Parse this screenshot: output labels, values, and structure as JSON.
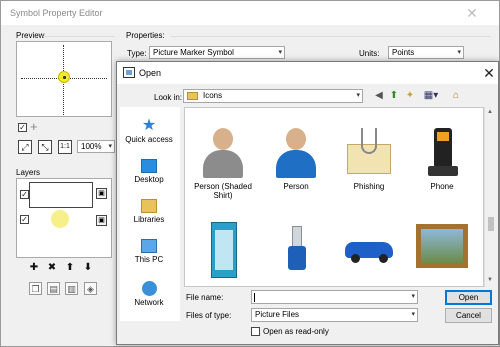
{
  "editor": {
    "title": "Symbol Property Editor",
    "preview_label": "Preview",
    "properties_label": "Properties:",
    "type_label": "Type:",
    "type_value": "Picture Marker Symbol",
    "units_label": "Units:",
    "units_value": "Points",
    "zoom_value": "100%",
    "layers_label": "Layers"
  },
  "open_dialog": {
    "title": "Open",
    "look_in_label": "Look in:",
    "look_in_value": "Icons",
    "places": [
      {
        "label": "Quick access",
        "icon": "star-icon"
      },
      {
        "label": "Desktop",
        "icon": "desktop-icon"
      },
      {
        "label": "Libraries",
        "icon": "libraries-icon"
      },
      {
        "label": "This PC",
        "icon": "computer-icon"
      },
      {
        "label": "Network",
        "icon": "network-icon"
      }
    ],
    "files": [
      {
        "label": "Person (Shaded Shirt)",
        "icon": "person-shaded-shirt-icon"
      },
      {
        "label": "Person",
        "icon": "person-icon"
      },
      {
        "label": "Phishing",
        "icon": "phishing-icon"
      },
      {
        "label": "Phone",
        "icon": "phone-icon"
      },
      {
        "label": "",
        "icon": "phone-booth-icon"
      },
      {
        "label": "",
        "icon": "usb-drive-icon"
      },
      {
        "label": "",
        "icon": "car-icon"
      },
      {
        "label": "",
        "icon": "framed-picture-icon"
      }
    ],
    "file_name_label": "File name:",
    "file_name_value": "",
    "files_of_type_label": "Files of type:",
    "files_of_type_value": "Picture Files",
    "read_only_label": "Open as read-only",
    "open_button": "Open",
    "cancel_button": "Cancel"
  },
  "colors": {
    "marker_yellow": "#f5e92a",
    "accent": "#0078d7",
    "folder": "#e8c25a"
  }
}
